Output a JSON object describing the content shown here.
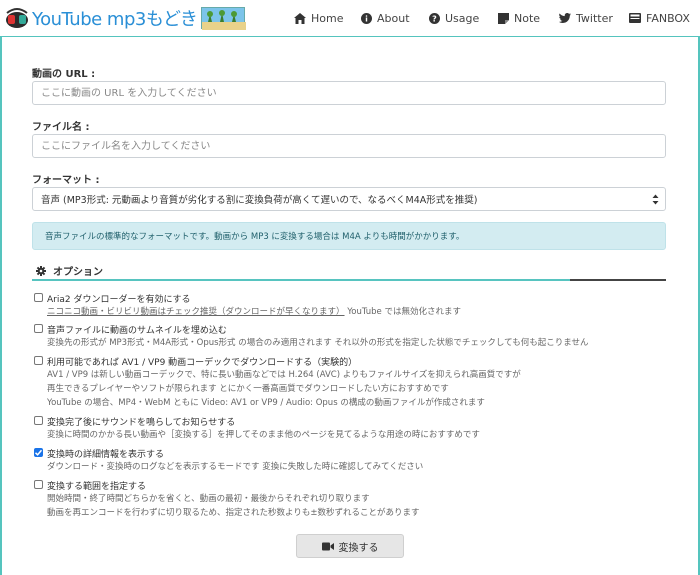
{
  "header": {
    "logo_text": "YouTube mp3もどき",
    "nav": [
      {
        "label": "Home",
        "icon": "home-icon"
      },
      {
        "label": "About",
        "icon": "info-icon"
      },
      {
        "label": "Usage",
        "icon": "question-icon"
      },
      {
        "label": "Note",
        "icon": "note-icon"
      },
      {
        "label": "Twitter",
        "icon": "twitter-icon"
      },
      {
        "label": "FANBOX",
        "icon": "fanbox-icon"
      }
    ]
  },
  "form": {
    "url_label": "動画の URL :",
    "url_placeholder": "ここに動画の URL を入力してください",
    "url_value": "",
    "filename_label": "ファイル名 :",
    "filename_placeholder": "ここにファイル名を入力してください",
    "filename_value": "",
    "format_label": "フォーマット :",
    "format_selected": "音声 (MP3形式: 元動画より音質が劣化する割に変換負荷が高くて遅いので、なるべくM4A形式を推奨)",
    "info_text": "音声ファイルの標準的なフォーマットです。動画から MP3 に変換する場合は M4A よりも時間がかかります。"
  },
  "options": {
    "title": "オプション",
    "items": [
      {
        "title": "Aria2 ダウンローダーを有効にする",
        "desc": [
          "ニコニコ動画・ビリビリ動画はチェック推奨（ダウンロードが早くなります） YouTube では無効化されます"
        ],
        "checked": false
      },
      {
        "title": "音声ファイルに動画のサムネイルを埋め込む",
        "desc": [
          "変換先の形式が MP3形式・M4A形式・Opus形式 の場合のみ適用されます それ以外の形式を指定した状態でチェックしても何も起こりません"
        ],
        "checked": false
      },
      {
        "title": "利用可能であれば AV1 / VP9 動画コーデックでダウンロードする（実験的）",
        "desc": [
          "AV1 / VP9 は新しい動画コーデックで、特に長い動画などでは H.264 (AVC) よりもファイルサイズを抑えられ高画質ですが",
          "再生できるプレイヤーやソフトが限られます とにかく一番高画質でダウンロードしたい方におすすめです",
          "YouTube の場合、MP4・WebM ともに Video: AV1 or VP9 / Audio: Opus の構成の動画ファイルが作成されます"
        ],
        "checked": false
      },
      {
        "title": "変換完了後にサウンドを鳴らしてお知らせする",
        "desc": [
          "変換に時間のかかる長い動画や［変換する］を押してそのまま他のページを見てるような用途の時におすすめです"
        ],
        "checked": false
      },
      {
        "title": "変換時の詳細情報を表示する",
        "desc": [
          "ダウンロード・変換時のログなどを表示するモードです 変換に失敗した時に確認してみてください"
        ],
        "checked": true
      },
      {
        "title": "変換する範囲を指定する",
        "desc": [
          "開始時間・終了時間どちらかを省くと、動画の最初・最後からそれぞれ切り取ります",
          "動画を再エンコードを行わずに切り取るため、指定された秒数よりも±数秒ずれることがあります"
        ],
        "checked": false
      }
    ]
  },
  "convert_button": "変換する"
}
